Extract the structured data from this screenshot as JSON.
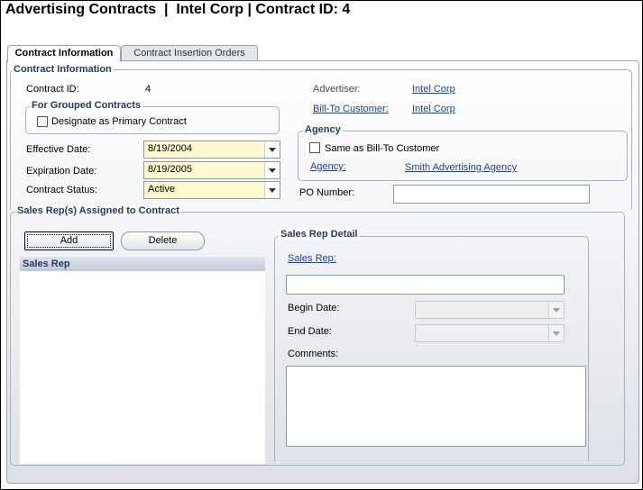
{
  "header": {
    "title": "Advertising Contracts  |  Intel Corp | Contract ID: 4"
  },
  "tabs": [
    {
      "label": "Contract Information",
      "active": true
    },
    {
      "label": "Contract Insertion Orders",
      "active": false
    }
  ],
  "contract_info": {
    "legend": "Contract Information",
    "contract_id_label": "Contract ID:",
    "contract_id_value": "4",
    "grouped": {
      "legend": "For Grouped Contracts",
      "primary_label": "Designate as Primary Contract",
      "primary_checked": false
    },
    "effective_date_label": "Effective Date:",
    "effective_date_value": "8/19/2004",
    "expiration_date_label": "Expiration Date:",
    "expiration_date_value": "8/19/2005",
    "contract_status_label": "Contract Status:",
    "contract_status_value": "Active",
    "advertiser_label": "Advertiser:",
    "advertiser_value": "Intel Corp",
    "bill_to_label": "Bill-To Customer:",
    "bill_to_value": "Intel Corp",
    "agency": {
      "legend": "Agency",
      "same_as_label": "Same as Bill-To Customer",
      "same_as_checked": false,
      "agency_label": "Agency:",
      "agency_value": "Smith Advertising Agency"
    },
    "po_number_label": "PO Number:",
    "po_number_value": ""
  },
  "sales_reps": {
    "legend": "Sales Rep(s) Assigned to Contract",
    "add_label": "Add",
    "delete_label": "Delete",
    "list_header": "Sales Rep",
    "detail": {
      "legend": "Sales Rep Detail",
      "sales_rep_label": "Sales Rep:",
      "begin_date_label": "Begin Date:",
      "end_date_label": "End Date:",
      "comments_label": "Comments:"
    }
  },
  "colors": {
    "accent": "#1f3b6b",
    "link": "#1a3fa8",
    "required_field": "#fff9cf"
  }
}
